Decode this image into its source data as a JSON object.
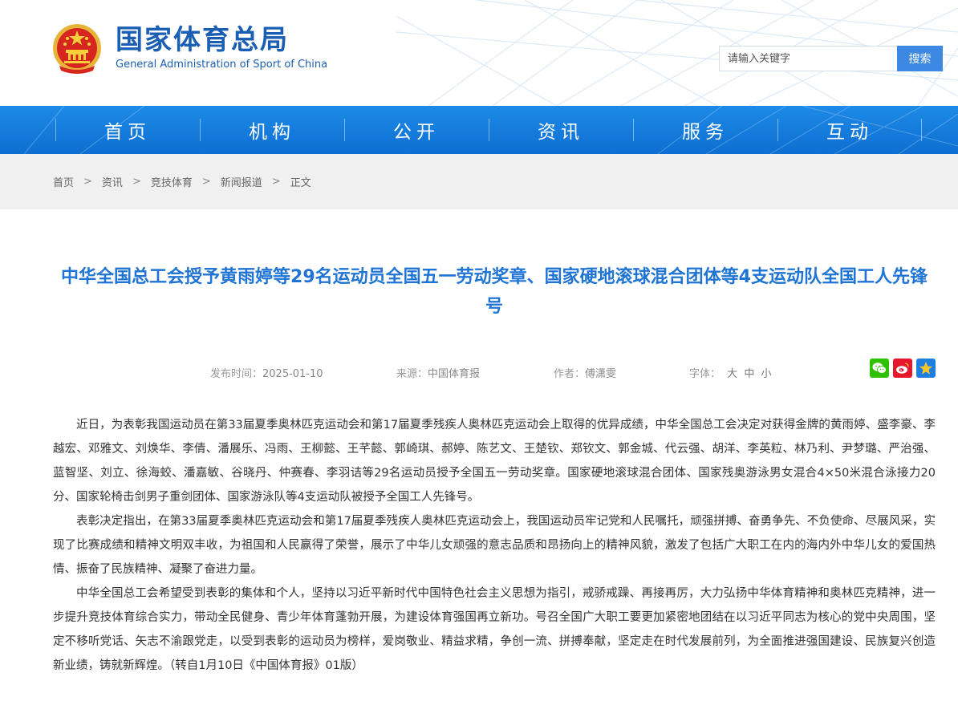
{
  "header": {
    "title_cn": "国家体育总局",
    "title_en": "General Administration of Sport of China",
    "search_placeholder": "请输入关键字",
    "search_button": "搜索"
  },
  "nav": [
    "首页",
    "机构",
    "公开",
    "资讯",
    "服务",
    "互动"
  ],
  "breadcrumb": [
    "首页",
    "资讯",
    "竞技体育",
    "新闻报道",
    "正文"
  ],
  "article": {
    "title": "中华全国总工会授予黄雨婷等29名运动员全国五一劳动奖章、国家硬地滚球混合团体等4支运动队全国工人先锋号",
    "publish_label": "发布时间：",
    "publish_date": "2025-01-10",
    "source_label": "来源：",
    "source": "中国体育报",
    "author_label": "作者：",
    "author": "傅潇雯",
    "font_label": "字体：",
    "font_sizes": [
      "大",
      "中",
      "小"
    ],
    "share_icons": [
      "wechat-icon",
      "weibo-icon",
      "favorite-star-icon"
    ],
    "paragraphs": [
      "近日，为表彰我国运动员在第33届夏季奥林匹克运动会和第17届夏季残疾人奥林匹克运动会上取得的优异成绩，中华全国总工会决定对获得金牌的黄雨婷、盛李豪、李越宏、邓雅文、刘焕华、李倩、潘展乐、冯雨、王柳懿、王芊懿、郭崎琪、郝婷、陈艺文、王楚钦、郑钦文、郭金城、代云强、胡洋、李英粒、林乃利、尹梦璐、严治强、蓝智坚、刘立、徐海蛟、潘嘉敏、谷晓丹、仲赛春、李羽诘等29名运动员授予全国五一劳动奖章。国家硬地滚球混合团体、国家残奥游泳男女混合4×50米混合泳接力20分、国家轮椅击剑男子重剑团体、国家游泳队等4支运动队被授予全国工人先锋号。",
      "表彰决定指出，在第33届夏季奥林匹克运动会和第17届夏季残疾人奥林匹克运动会上，我国运动员牢记党和人民嘱托，顽强拼搏、奋勇争先、不负使命、尽展风采，实现了比赛成绩和精神文明双丰收，为祖国和人民赢得了荣誉，展示了中华儿女顽强的意志品质和昂扬向上的精神风貌，激发了包括广大职工在内的海内外中华儿女的爱国热情、振奋了民族精神、凝聚了奋进力量。",
      "中华全国总工会希望受到表彰的集体和个人，坚持以习近平新时代中国特色社会主义思想为指引，戒骄戒躁、再接再厉，大力弘扬中华体育精神和奥林匹克精神，进一步提升竞技体育综合实力，带动全民健身、青少年体育蓬勃开展，为建设体育强国再立新功。号召全国广大职工要更加紧密地团结在以习近平同志为核心的党中央周围，坚定不移听党话、矢志不渝跟党走，以受到表彰的运动员为榜样，爱岗敬业、精益求精，争创一流、拼搏奉献，坚定走在时代发展前列，为全面推进强国建设、民族复兴创造新业绩，铸就新辉煌。（转自1月10日《中国体育报》01版）"
    ]
  },
  "colors": {
    "brand_blue": "#1a5fb4",
    "nav_blue": "#1179dc",
    "title_blue": "#1f74d4",
    "search_button": "#3d88e3"
  }
}
